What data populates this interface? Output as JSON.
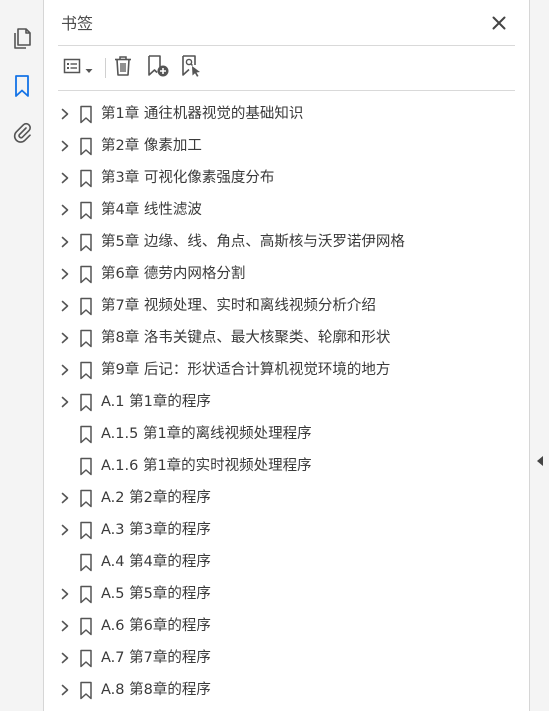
{
  "panel": {
    "title": "书签"
  },
  "rail": {
    "icons": [
      "pages-icon",
      "bookmark-icon",
      "attachment-icon"
    ]
  },
  "colors": {
    "accent": "#1473e6",
    "icon": "#555555",
    "text": "#3a3a3a"
  },
  "bookmarks": [
    {
      "label": "第1章  通往机器视觉的基础知识",
      "expandable": true
    },
    {
      "label": "第2章  像素加工",
      "expandable": true
    },
    {
      "label": "第3章  可视化像素强度分布",
      "expandable": true
    },
    {
      "label": "第4章  线性滤波",
      "expandable": true
    },
    {
      "label": "第5章  边缘、线、角点、高斯核与沃罗诺伊网格",
      "expandable": true
    },
    {
      "label": "第6章  德劳内网格分割",
      "expandable": true
    },
    {
      "label": "第7章  视频处理、实时和离线视频分析介绍",
      "expandable": true
    },
    {
      "label": "第8章  洛韦关键点、最大核聚类、轮廓和形状",
      "expandable": true
    },
    {
      "label": "第9章  后记：形状适合计算机视觉环境的地方",
      "expandable": true
    },
    {
      "label": "A.1  第1章的程序",
      "expandable": true
    },
    {
      "label": "A.1.5  第1章的离线视频处理程序",
      "expandable": false
    },
    {
      "label": "A.1.6  第1章的实时视频处理程序",
      "expandable": false
    },
    {
      "label": "A.2  第2章的程序",
      "expandable": true
    },
    {
      "label": "A.3  第3章的程序",
      "expandable": true
    },
    {
      "label": "A.4  第4章的程序",
      "expandable": false
    },
    {
      "label": "A.5  第5章的程序",
      "expandable": true
    },
    {
      "label": "A.6  第6章的程序",
      "expandable": true
    },
    {
      "label": "A.7  第7章的程序",
      "expandable": true
    },
    {
      "label": "A.8  第8章的程序",
      "expandable": true
    }
  ]
}
